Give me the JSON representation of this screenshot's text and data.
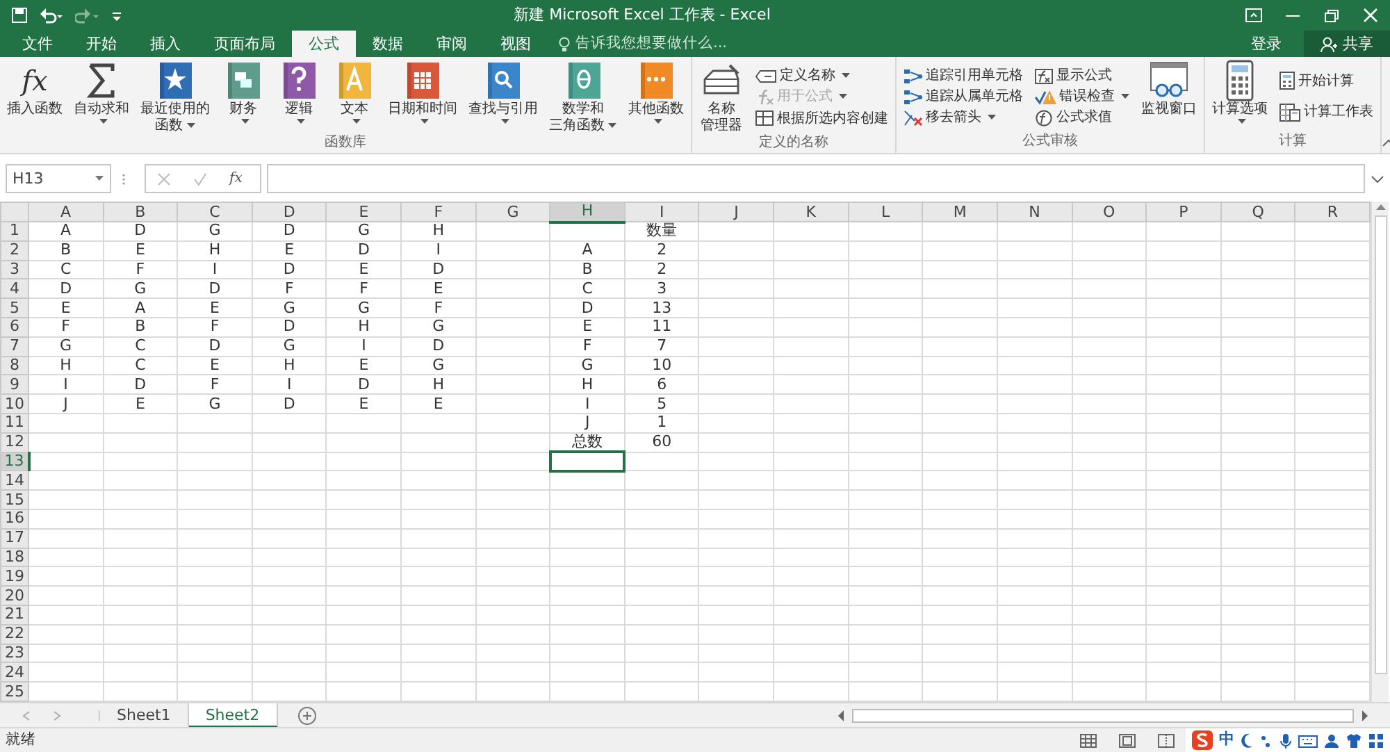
{
  "title_bar": {
    "title": "新建 Microsoft Excel 工作表 - Excel"
  },
  "tabs": [
    {
      "label": "文件",
      "selected": false
    },
    {
      "label": "开始",
      "selected": false
    },
    {
      "label": "插入",
      "selected": false
    },
    {
      "label": "页面布局",
      "selected": false
    },
    {
      "label": "公式",
      "selected": true
    },
    {
      "label": "数据",
      "selected": false
    },
    {
      "label": "审阅",
      "selected": false
    },
    {
      "label": "视图",
      "selected": false
    }
  ],
  "tell_me": {
    "placeholder": "告诉我您想要做什么..."
  },
  "account": {
    "sign_in": "登录",
    "share": "共享"
  },
  "ribbon": {
    "groups": [
      {
        "title": "函数库",
        "items": [
          {
            "kind": "large",
            "icon_text": "fx",
            "lines": [
              "插入函数"
            ],
            "dropdown": false
          },
          {
            "kind": "large",
            "lines": [
              "自动求和"
            ],
            "dropdown": true
          },
          {
            "kind": "large",
            "lines": [
              "最近使用的",
              "函数"
            ],
            "dropdown": true
          },
          {
            "kind": "large",
            "lines": [
              "财务"
            ],
            "dropdown": true
          },
          {
            "kind": "large",
            "lines": [
              "逻辑"
            ],
            "dropdown": true
          },
          {
            "kind": "large",
            "lines": [
              "文本"
            ],
            "dropdown": true
          },
          {
            "kind": "large",
            "lines": [
              "日期和时间"
            ],
            "dropdown": true
          },
          {
            "kind": "large",
            "lines": [
              "查找与引用"
            ],
            "dropdown": true
          },
          {
            "kind": "large",
            "lines": [
              "数学和",
              "三角函数"
            ],
            "dropdown": true
          },
          {
            "kind": "large",
            "lines": [
              "其他函数"
            ],
            "dropdown": true
          }
        ]
      },
      {
        "title": "定义的名称",
        "items": [
          {
            "kind": "large",
            "lines": [
              "名称",
              "管理器"
            ],
            "dropdown": false
          },
          {
            "kind": "stack",
            "items": [
              {
                "label": "定义名称",
                "dropdown": true,
                "disabled": false
              },
              {
                "label": "用于公式",
                "dropdown": true,
                "disabled": true
              },
              {
                "label": "根据所选内容创建",
                "dropdown": false,
                "disabled": false
              }
            ]
          }
        ]
      },
      {
        "title": "公式审核",
        "items": [
          {
            "kind": "stack",
            "items": [
              {
                "label": "追踪引用单元格",
                "dropdown": false,
                "disabled": false
              },
              {
                "label": "追踪从属单元格",
                "dropdown": false,
                "disabled": false
              },
              {
                "label": "移去箭头",
                "dropdown": true,
                "disabled": false
              }
            ]
          },
          {
            "kind": "stack",
            "items": [
              {
                "label": "显示公式",
                "dropdown": false,
                "disabled": false
              },
              {
                "label": "错误检查",
                "dropdown": true,
                "disabled": false
              },
              {
                "label": "公式求值",
                "dropdown": false,
                "disabled": false
              }
            ]
          },
          {
            "kind": "large",
            "lines": [
              "监视窗口"
            ],
            "dropdown": false
          }
        ]
      },
      {
        "title": "计算",
        "items": [
          {
            "kind": "large",
            "lines": [
              "计算选项"
            ],
            "dropdown": true
          },
          {
            "kind": "stack",
            "items": [
              {
                "label": "开始计算",
                "dropdown": false,
                "disabled": false
              },
              {
                "label": "计算工作表",
                "dropdown": false,
                "disabled": false
              }
            ]
          }
        ]
      }
    ]
  },
  "formula_bar": {
    "name_box": "H13",
    "fx": "fx"
  },
  "sheet": {
    "columns": [
      {
        "label": "A",
        "selected": false
      },
      {
        "label": "B",
        "selected": false
      },
      {
        "label": "C",
        "selected": false
      },
      {
        "label": "D",
        "selected": false
      },
      {
        "label": "E",
        "selected": false
      },
      {
        "label": "F",
        "selected": false
      },
      {
        "label": "G",
        "selected": false
      },
      {
        "label": "H",
        "selected": true
      },
      {
        "label": "I",
        "selected": false
      },
      {
        "label": "J",
        "selected": false
      },
      {
        "label": "K",
        "selected": false
      },
      {
        "label": "L",
        "selected": false
      },
      {
        "label": "M",
        "selected": false
      },
      {
        "label": "N",
        "selected": false
      },
      {
        "label": "O",
        "selected": false
      },
      {
        "label": "P",
        "selected": false
      },
      {
        "label": "Q",
        "selected": false
      },
      {
        "label": "R",
        "selected": false
      }
    ],
    "rows": [
      {
        "label": "1",
        "selected": false
      },
      {
        "label": "2",
        "selected": false
      },
      {
        "label": "3",
        "selected": false
      },
      {
        "label": "4",
        "selected": false
      },
      {
        "label": "5",
        "selected": false
      },
      {
        "label": "6",
        "selected": false
      },
      {
        "label": "7",
        "selected": false
      },
      {
        "label": "8",
        "selected": false
      },
      {
        "label": "9",
        "selected": false
      },
      {
        "label": "10",
        "selected": false
      },
      {
        "label": "11",
        "selected": false
      },
      {
        "label": "12",
        "selected": false
      },
      {
        "label": "13",
        "selected": true
      },
      {
        "label": "14",
        "selected": false
      },
      {
        "label": "15",
        "selected": false
      },
      {
        "label": "16",
        "selected": false
      },
      {
        "label": "17",
        "selected": false
      },
      {
        "label": "18",
        "selected": false
      },
      {
        "label": "19",
        "selected": false
      },
      {
        "label": "20",
        "selected": false
      },
      {
        "label": "21",
        "selected": false
      },
      {
        "label": "22",
        "selected": false
      },
      {
        "label": "23",
        "selected": false
      },
      {
        "label": "24",
        "selected": false
      },
      {
        "label": "25",
        "selected": false
      }
    ],
    "data_rows": [
      [
        "A",
        "D",
        "G",
        "D",
        "G",
        "H"
      ],
      [
        "B",
        "E",
        "H",
        "E",
        "D",
        "I"
      ],
      [
        "C",
        "F",
        "I",
        "D",
        "E",
        "D"
      ],
      [
        "D",
        "G",
        "D",
        "F",
        "F",
        "E"
      ],
      [
        "E",
        "A",
        "E",
        "G",
        "G",
        "F"
      ],
      [
        "F",
        "B",
        "F",
        "D",
        "H",
        "G"
      ],
      [
        "G",
        "C",
        "D",
        "G",
        "I",
        "D"
      ],
      [
        "H",
        "C",
        "E",
        "H",
        "E",
        "G"
      ],
      [
        "I",
        "D",
        "F",
        "I",
        "D",
        "H"
      ],
      [
        "J",
        "E",
        "G",
        "D",
        "E",
        "E"
      ]
    ],
    "count_table": {
      "header": "数量",
      "rows": [
        {
          "name": "A",
          "count": "2"
        },
        {
          "name": "B",
          "count": "2"
        },
        {
          "name": "C",
          "count": "3"
        },
        {
          "name": "D",
          "count": "13"
        },
        {
          "name": "E",
          "count": "11"
        },
        {
          "name": "F",
          "count": "7"
        },
        {
          "name": "G",
          "count": "10"
        },
        {
          "name": "H",
          "count": "6"
        },
        {
          "name": "I",
          "count": "5"
        },
        {
          "name": "J",
          "count": "1"
        }
      ],
      "total": {
        "label": "总数",
        "value": "60"
      }
    }
  },
  "sheet_tabs": [
    {
      "label": "Sheet1",
      "selected": false
    },
    {
      "label": "Sheet2",
      "selected": true
    }
  ],
  "status_bar": {
    "status": "就绪",
    "ime": "中"
  }
}
